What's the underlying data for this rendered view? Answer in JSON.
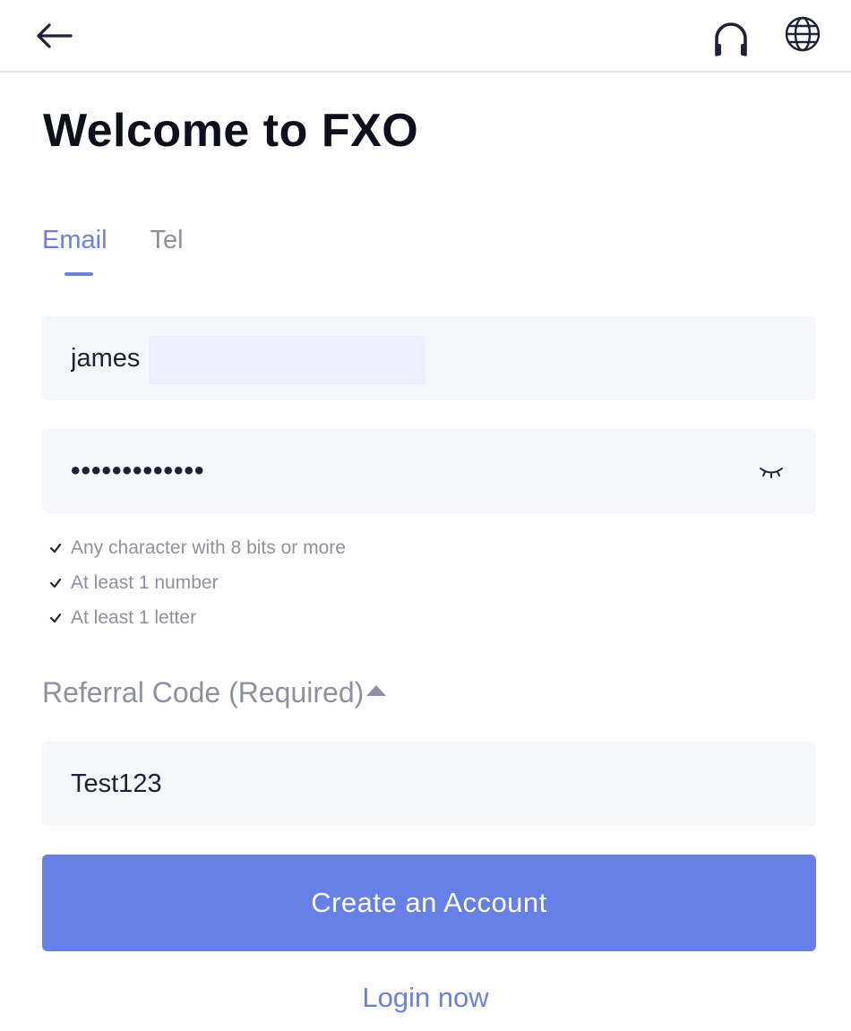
{
  "header": {
    "back_icon": "arrow-left-icon",
    "support_icon": "headphones-icon",
    "language_icon": "globe-icon"
  },
  "page": {
    "title": "Welcome to FXO"
  },
  "tabs": [
    {
      "label": "Email",
      "active": true
    },
    {
      "label": "Tel",
      "active": false
    }
  ],
  "form": {
    "email": {
      "value": "james"
    },
    "password": {
      "value": "•••••••••••••",
      "visibility_icon": "eye-closed-icon"
    },
    "password_rules": [
      "Any character with 8 bits or more",
      "At least 1 number",
      "At least 1 letter"
    ],
    "referral": {
      "toggle_label": "Referral Code (Required)",
      "toggle_icon": "caret-up-icon",
      "value": "Test123"
    },
    "submit_label": "Create an Account",
    "login_link": "Login now"
  },
  "colors": {
    "accent": "#6780e8",
    "field_background": "#f6f7fa",
    "muted_text": "#8e90a0",
    "title_text": "#0d0f1a"
  }
}
